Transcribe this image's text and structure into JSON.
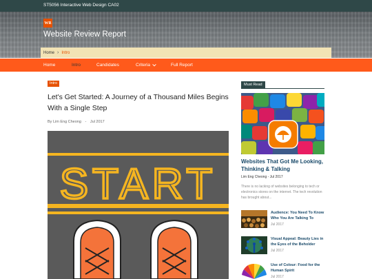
{
  "topbar": {
    "text": "ST5056 Interactive Web Design CA02"
  },
  "header": {
    "logo_text": "WR",
    "site_title": "Website Review Report"
  },
  "breadcrumb": {
    "home": "Home",
    "separator": "›",
    "current": "Intro"
  },
  "nav": [
    {
      "label": "Home",
      "active": false
    },
    {
      "label": "Intro",
      "active": true
    },
    {
      "label": "Candidates",
      "active": false
    },
    {
      "label": "Criteria",
      "active": false,
      "has_dropdown": true
    },
    {
      "label": "Full Report",
      "active": false
    }
  ],
  "article": {
    "tag": "Intro",
    "title": "Let's Get Started: A Journey of a Thousand Miles Begins With a Single Step",
    "author": "By Lim Eng Cheong",
    "separator": "-",
    "date": "Jul 2017",
    "hero_text": "START"
  },
  "sidebar": {
    "label": "Must Read",
    "feature": {
      "title": "Websites That Got Me Looking, Thinking & Talking",
      "meta": "Lim Eng Cheong - Jul 2017",
      "excerpt": "There is no lacking of websites belonging to tech or electronics stores on the internet. The tech revolution has brought about..."
    },
    "items": [
      {
        "title": "Audience: You Need To Know Who You Are Talking To",
        "date": "Jul 2017",
        "icon": "crowd-thumbnail"
      },
      {
        "title": "Visual Appeal: Beauty Lies in the Eyes of the Beholder",
        "date": "Jul 2017",
        "icon": "peacock-thumbnail"
      },
      {
        "title": "Use of Colour: Food for the Human Spirit",
        "date": "Jul 2017",
        "icon": "colour-wheel-thumbnail"
      }
    ]
  },
  "colors": {
    "brand_orange": "#ff5a1b",
    "dark_teal": "#2f4848",
    "link_blue": "#1a4a6a",
    "breadcrumb_bg": "#f2e3b5"
  }
}
